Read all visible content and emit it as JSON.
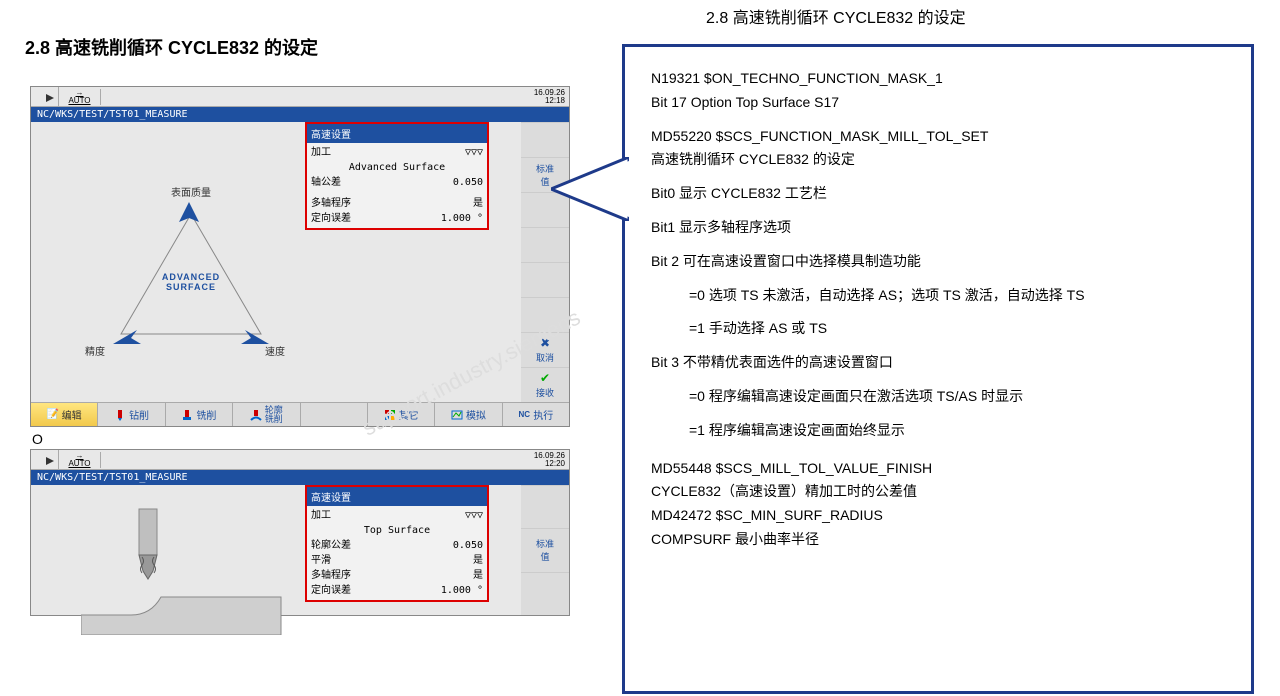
{
  "header": {
    "right": "2.8  高速铣削循环 CYCLE832 的设定",
    "left": "2.8 高速铣削循环 CYCLE832 的设定"
  },
  "cnc": {
    "auto_label": "AUTO",
    "date": "16.09.26",
    "time": "12:18",
    "date2": "16.09.26",
    "time2": "12:20",
    "path": "NC/WKS/TEST/TST01_MEASURE",
    "dialog1": {
      "title": "高速设置",
      "rows": {
        "r1l": "加工",
        "r1v": "▽▽▽",
        "r2l": "",
        "r2v": "Advanced Surface",
        "r3l": "轴公差",
        "r3v": "0.050",
        "r4l": "多轴程序",
        "r4v": "是",
        "r5l": "定向误差",
        "r5v": "1.000 °"
      }
    },
    "dialog2": {
      "title": "高速设置",
      "rows": {
        "r1l": "加工",
        "r1v": "▽▽▽",
        "r2l": "",
        "r2v": "Top Surface",
        "r3l": "轮廓公差",
        "r3v": "0.050",
        "r4l": "平滑",
        "r4v": "是",
        "r5l": "多轴程序",
        "r5v": "是",
        "r6l": "定向误差",
        "r6v": "1.000 °"
      }
    },
    "triangle": {
      "top": "表面质量",
      "bl": "精度",
      "br": "速度",
      "center1": "ADVANCED",
      "center2": "SURFACE"
    },
    "softkeys_right": {
      "std": "标准\n值",
      "cancel": "取消",
      "accept": "接收"
    },
    "softkeys_bottom": {
      "b1": "编辑",
      "b2": "钻削",
      "b3": "铣削",
      "b4": "轮廓\n铣削",
      "b5": "",
      "b6": "其它",
      "b7": "模拟",
      "b8": "执行"
    },
    "o_label": "O"
  },
  "callout": {
    "l1": "N19321 $ON_TECHNO_FUNCTION_MASK_1",
    "l2": "Bit  17 Option Top Surface S17",
    "l3": "MD55220  $SCS_FUNCTION_MASK_MILL_TOL_SET",
    "l4": "高速铣削循环 CYCLE832 的设定",
    "l5": "Bit0 显示 CYCLE832 工艺栏",
    "l6": "Bit1 显示多轴程序选项",
    "l7": "Bit 2 可在高速设置窗口中选择模具制造功能",
    "l7a": "=0 选项 TS 未激活，自动选择 AS；选项 TS 激活，自动选择 TS",
    "l7b": "=1 手动选择 AS 或 TS",
    "l8": "Bit 3 不带精优表面选件的高速设置窗口",
    "l8a": "=0 程序编辑高速设定画面只在激活选项 TS/AS 时显示",
    "l8b": "=1 程序编辑高速设定画面始终显示",
    "l9": "MD55448 $SCS_MILL_TOL_VALUE_FINISH",
    "l10": "CYCLE832（高速设置）精加工时的公差值",
    "l11": "MD42472 $SC_MIN_SURF_RADIUS",
    "l12": "COMPSURF 最小曲率半径"
  },
  "watermark": "support.industry.siemens"
}
